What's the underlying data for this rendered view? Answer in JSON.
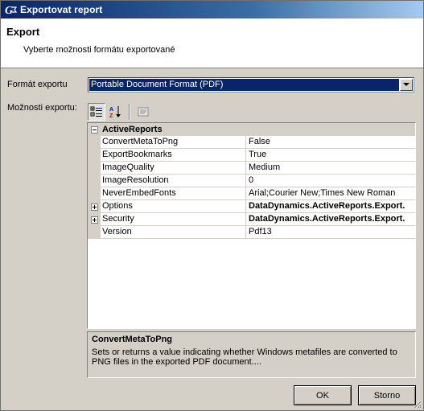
{
  "window": {
    "title": "Exportovat report",
    "app_icon": "activereports-logo-icon"
  },
  "header": {
    "title": "Export",
    "subtitle": "Vyberte  možnosti  formátu exportované"
  },
  "format": {
    "label": "Formát exportu",
    "selected": "Portable Document Format (PDF)"
  },
  "options": {
    "label": "Možnosti exportu:",
    "toolbar": [
      {
        "name": "categorized-view-icon",
        "pressed": true
      },
      {
        "name": "alphabetical-sort-icon",
        "pressed": false
      },
      {
        "name": "property-pages-icon",
        "pressed": false
      }
    ]
  },
  "property_grid": {
    "category": "ActiveReports",
    "rows": [
      {
        "name": "ConvertMetaToPng",
        "value": "False",
        "expandable": false,
        "bold": false
      },
      {
        "name": "ExportBookmarks",
        "value": "True",
        "expandable": false,
        "bold": false
      },
      {
        "name": "ImageQuality",
        "value": "Medium",
        "expandable": false,
        "bold": false
      },
      {
        "name": "ImageResolution",
        "value": "0",
        "expandable": false,
        "bold": false
      },
      {
        "name": "NeverEmbedFonts",
        "value": "Arial;Courier New;Times New Roman",
        "expandable": false,
        "bold": false
      },
      {
        "name": "Options",
        "value": "DataDynamics.ActiveReports.Export.",
        "expandable": true,
        "bold": true
      },
      {
        "name": "Security",
        "value": "DataDynamics.ActiveReports.Export.",
        "expandable": true,
        "bold": true
      },
      {
        "name": "Version",
        "value": "Pdf13",
        "expandable": false,
        "bold": false
      }
    ]
  },
  "description": {
    "title": "ConvertMetaToPng",
    "text": "Sets or returns a value indicating whether Windows metafiles are converted to PNG files in the exported PDF document...."
  },
  "buttons": {
    "ok": "OK",
    "cancel": "Storno"
  },
  "colors": {
    "titlebar_start": "#0a246a",
    "titlebar_end": "#a6caf0",
    "selection": "#0a246a",
    "face": "#d4d0c8"
  }
}
